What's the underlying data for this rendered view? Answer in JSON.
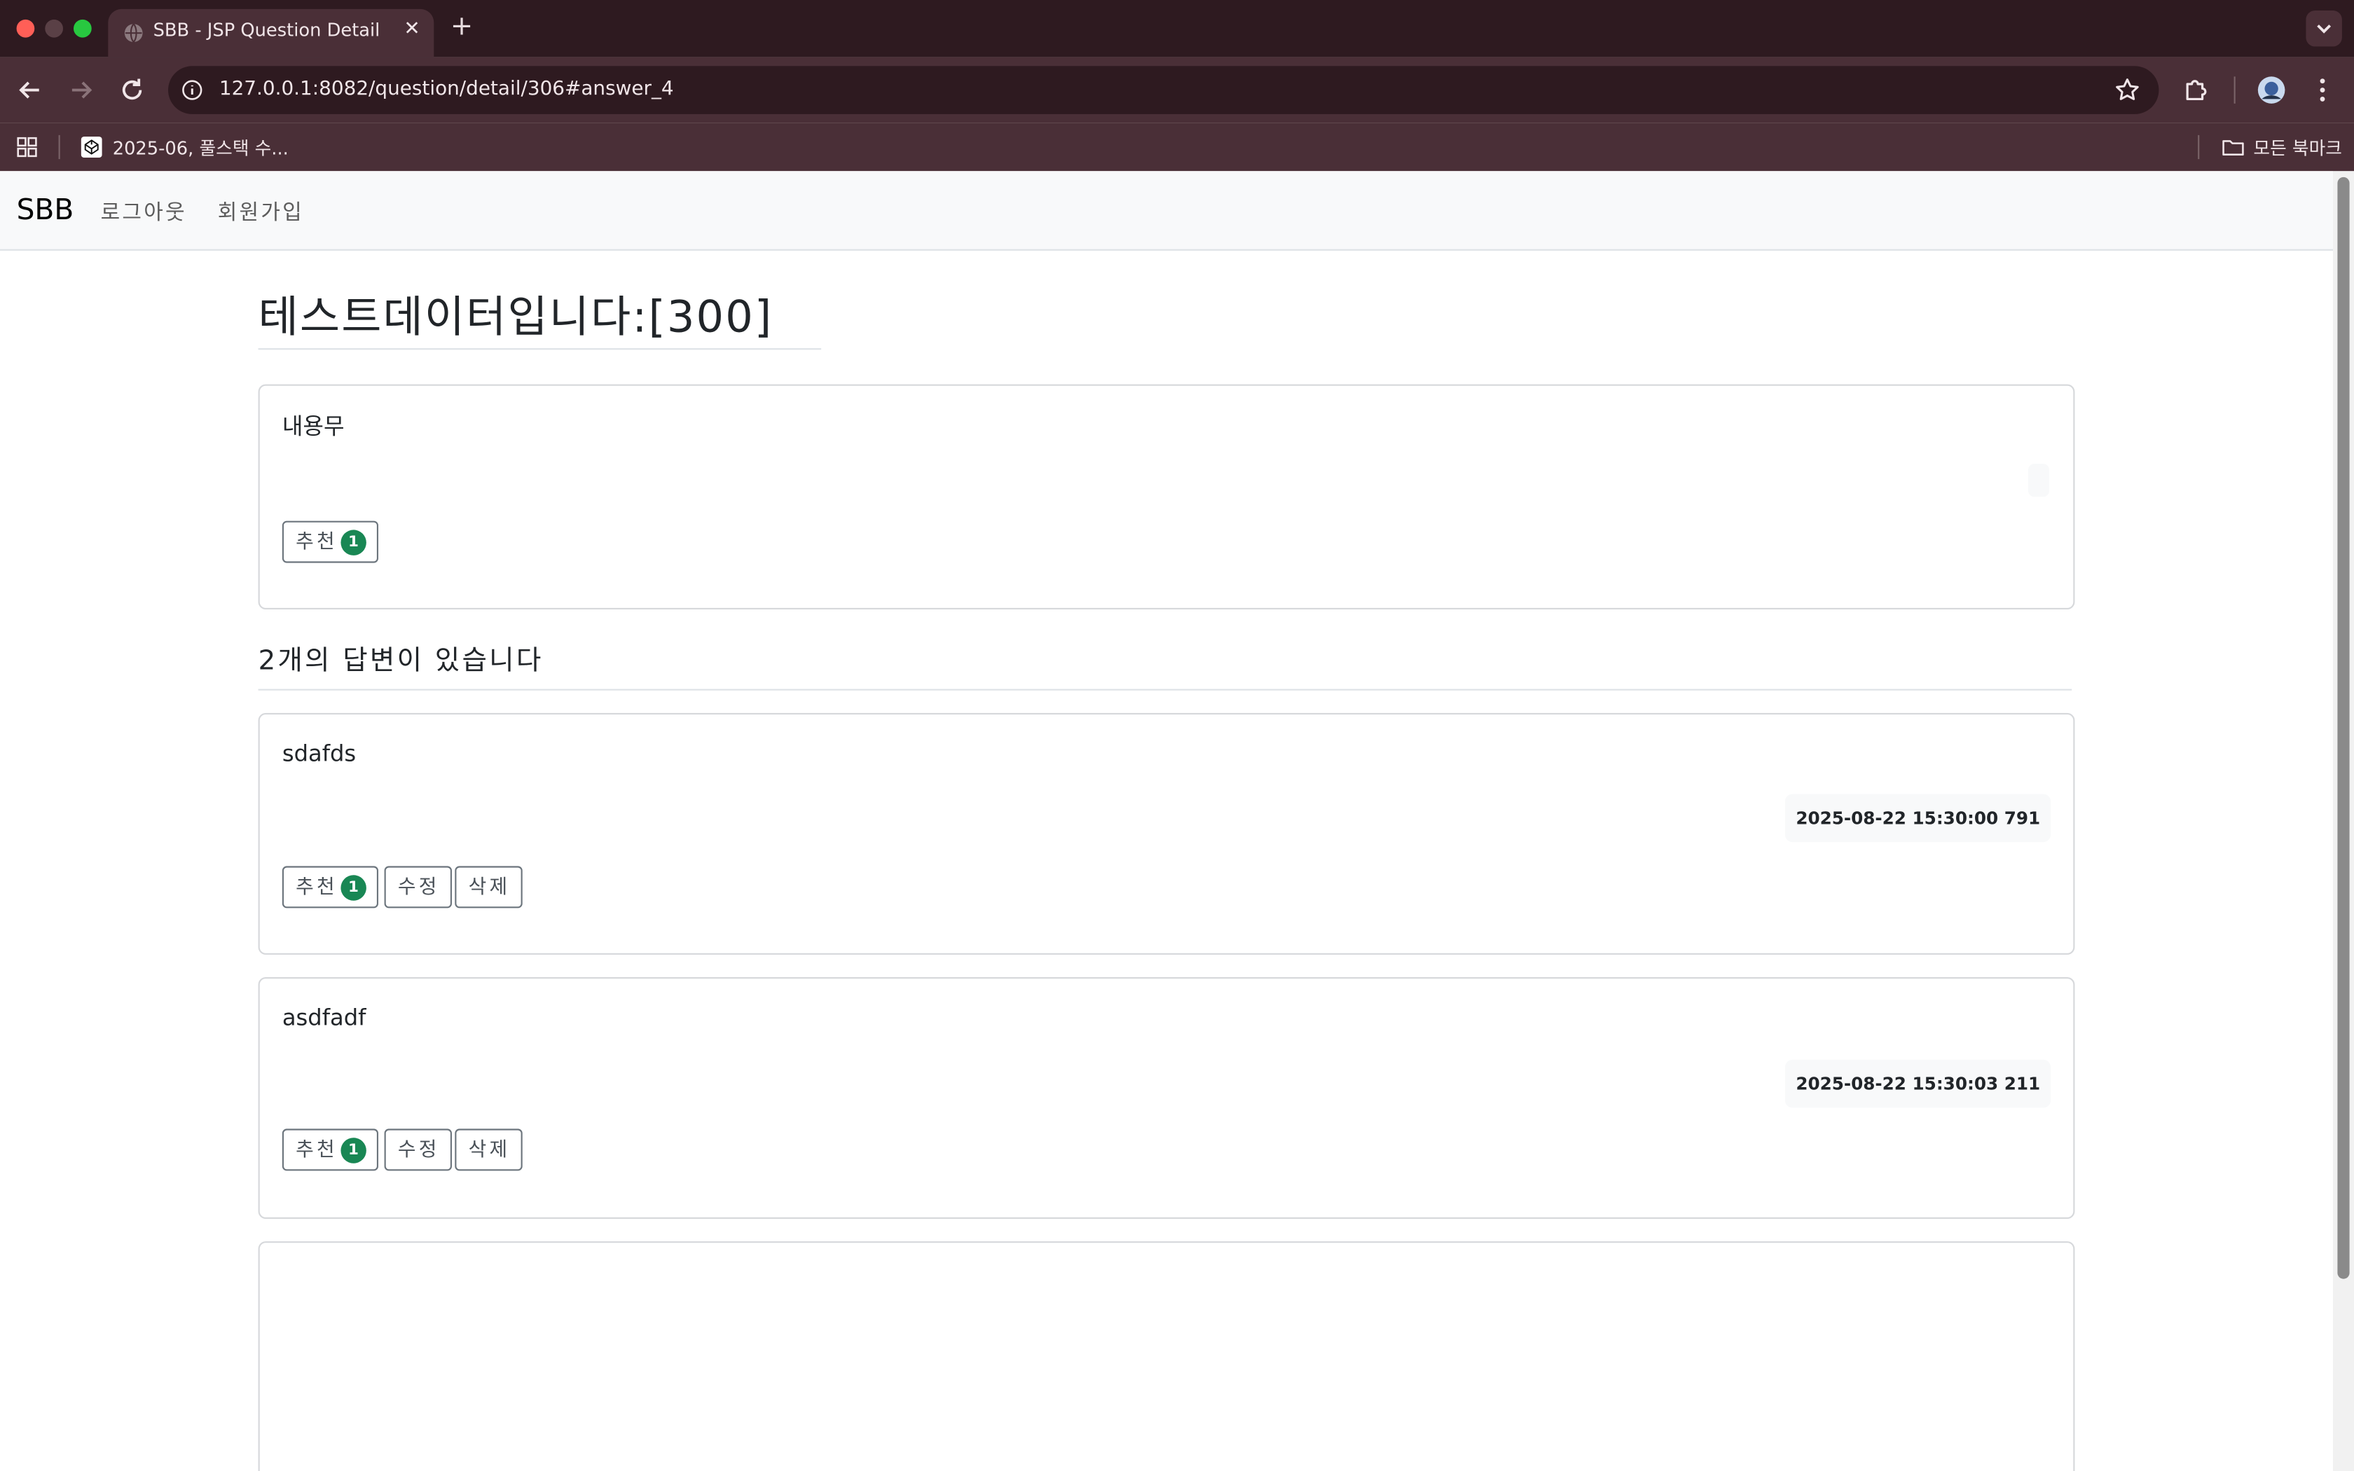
{
  "browser": {
    "tab_title": "SBB - JSP Question Detail",
    "url": "127.0.0.1:8082/question/detail/306#answer_4",
    "bookmark_label": "2025-06, 풀스택 수...",
    "all_bookmarks_label": "모든 북마크",
    "traffic_colors": [
      "#ff5f57",
      "#5a4046",
      "#28c840"
    ]
  },
  "navbar": {
    "brand": "SBB",
    "links": [
      "로그아웃",
      "회원가입"
    ]
  },
  "question": {
    "title": "테스트데이터입니다:[300]",
    "content": "내용무",
    "vote_label": "추천",
    "vote_count": "1"
  },
  "answers_heading": "2개의 답변이 있습니다",
  "answers": [
    {
      "content": "sdafds",
      "date": "2025-08-22 15:30:00 791",
      "vote_label": "추천",
      "vote_count": "1",
      "edit_label": "수정",
      "delete_label": "삭제"
    },
    {
      "content": "asdfadf",
      "date": "2025-08-22 15:30:03 211",
      "vote_label": "추천",
      "vote_count": "1",
      "edit_label": "수정",
      "delete_label": "삭제"
    }
  ],
  "colors": {
    "badge": "#198754",
    "chrome_dark": "#2e1a20",
    "chrome": "#4a2f37"
  }
}
